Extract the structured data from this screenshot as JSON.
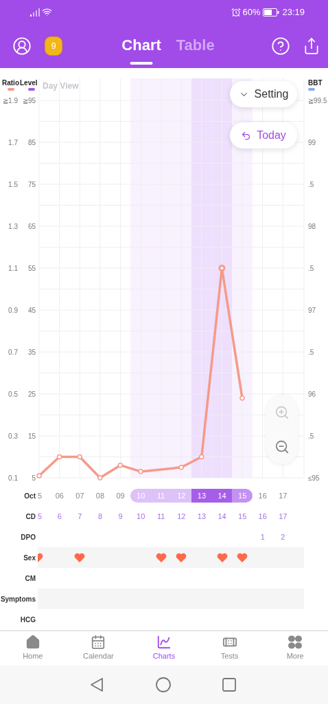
{
  "status_bar": {
    "battery": "60%",
    "time": "23:19"
  },
  "header": {
    "badge": "9",
    "tabs": [
      {
        "label": "Chart",
        "selected": true
      },
      {
        "label": "Table",
        "selected": false
      }
    ]
  },
  "chart": {
    "view_label": "Day View",
    "legend": [
      {
        "label": "Level",
        "color": "#9f5ce8"
      },
      {
        "label": "BBT",
        "color": "#8ca8f0"
      }
    ],
    "level_ticks": [
      "≧95",
      "85",
      "75",
      "65",
      "55",
      "45",
      "35",
      "25",
      "15",
      "5"
    ],
    "bbt_ticks": [
      "≧99.5",
      "99",
      ".5",
      "98",
      ".5",
      "97",
      ".5",
      "96",
      ".5",
      "≤95"
    ],
    "chart_data": {
      "type": "line",
      "grid": true,
      "series": [
        {
          "name": "Ratio",
          "color": "#f59a8a",
          "marker": "circle",
          "values": [
            0.11,
            0.2,
            0.2,
            0.1,
            0.16,
            0.13,
            null,
            0.15,
            0.2,
            1.1,
            0.48,
            null,
            null
          ]
        }
      ],
      "ylim": [
        0.1,
        1.9
      ],
      "yticks": [
        {
          "value": 1.9,
          "label": "≧1.9"
        },
        {
          "value": 1.7,
          "label": "1.7"
        },
        {
          "value": 1.5,
          "label": "1.5"
        },
        {
          "value": 1.3,
          "label": "1.3"
        },
        {
          "value": 1.1,
          "label": "1.1"
        },
        {
          "value": 0.9,
          "label": "0.9"
        },
        {
          "value": 0.7,
          "label": "0.7"
        },
        {
          "value": 0.5,
          "label": "0.5"
        },
        {
          "value": 0.3,
          "label": "0.3"
        },
        {
          "value": 0.1,
          "label": "0.1"
        }
      ]
    },
    "buttons": [
      {
        "kind": "setting",
        "label": "Setting"
      },
      {
        "kind": "today",
        "label": "Today"
      }
    ]
  },
  "rows": [
    {
      "label": "Oct",
      "kind": "date",
      "cells": [
        {
          "text": "5",
          "kind": "none"
        },
        {
          "text": "06",
          "kind": "none"
        },
        {
          "text": "07",
          "kind": "none"
        },
        {
          "text": "08",
          "kind": "none"
        },
        {
          "text": "09",
          "kind": "none"
        },
        {
          "text": "10",
          "kind": "fertile"
        },
        {
          "text": "11",
          "kind": "fertile"
        },
        {
          "text": "12",
          "kind": "fertile"
        },
        {
          "text": "13",
          "kind": "peak"
        },
        {
          "text": "14",
          "kind": "peak"
        },
        {
          "text": "15",
          "kind": "high"
        },
        {
          "text": "16",
          "kind": "none"
        },
        {
          "text": "17",
          "kind": "none"
        }
      ]
    },
    {
      "label": "CD",
      "kind": "number",
      "cells": [
        "5",
        "6",
        "7",
        "8",
        "9",
        "10",
        "11",
        "12",
        "13",
        "14",
        "15",
        "16",
        "17"
      ]
    },
    {
      "label": "DPO",
      "kind": "number",
      "cells": [
        null,
        null,
        null,
        null,
        null,
        null,
        null,
        null,
        null,
        null,
        null,
        "1",
        "2"
      ]
    },
    {
      "label": "Sex",
      "kind": "hearts",
      "marks": [
        true,
        false,
        true,
        false,
        false,
        false,
        true,
        true,
        false,
        true,
        true,
        false,
        false
      ]
    },
    {
      "label": "CM",
      "kind": "empty"
    },
    {
      "label": "Symptoms",
      "kind": "empty"
    },
    {
      "label": "HCG",
      "kind": "empty"
    }
  ],
  "bottom_nav": [
    {
      "kind": "home",
      "label": "Home",
      "selected": false
    },
    {
      "kind": "calendar",
      "label": "Calendar",
      "selected": false
    },
    {
      "kind": "charts",
      "label": "Charts",
      "selected": true
    },
    {
      "kind": "tests",
      "label": "Tests",
      "selected": false
    },
    {
      "kind": "more",
      "label": "More",
      "selected": false
    }
  ]
}
